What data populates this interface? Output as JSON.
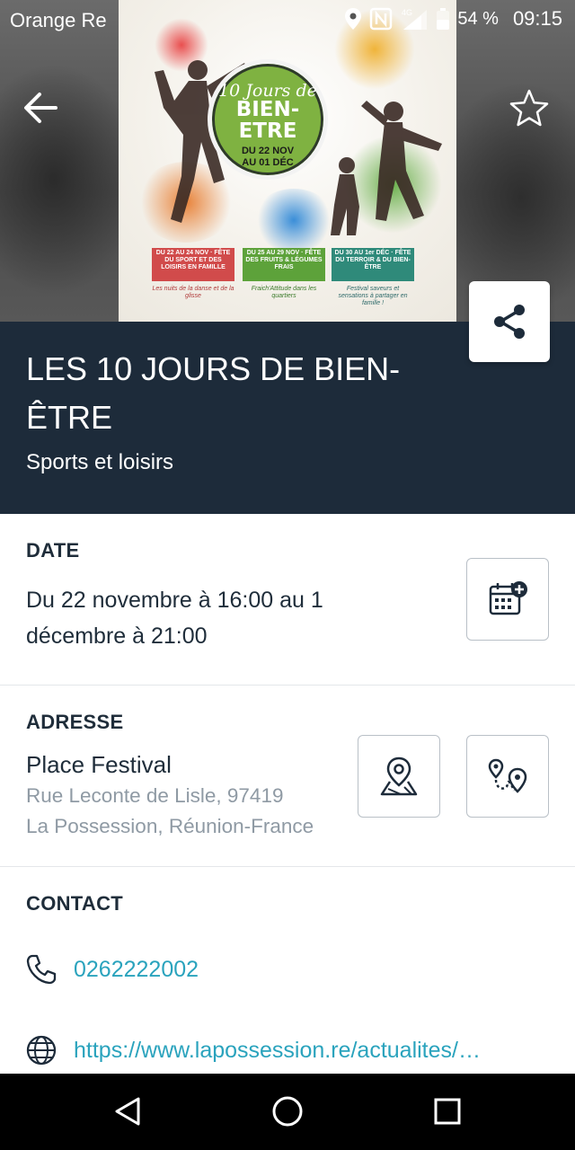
{
  "status_bar": {
    "carrier": "Orange Re",
    "network": "4G",
    "battery": "54 %",
    "time": "09:15"
  },
  "hero": {
    "poster": {
      "script_title": "10 Jours de",
      "main_title_line1": "BIEN-",
      "main_title_line2": "ETRE",
      "dates_line1": "DU 22 NOV",
      "dates_line2": "AU 01 DÉC",
      "banners": [
        {
          "text": "DU 22 AU 24 NOV · FÊTE DU SPORT ET DES LOISIRS EN FAMILLE",
          "note": "Les nuits de la danse et de la glisse"
        },
        {
          "text": "DU 25 AU 29 NOV · FÊTE DES FRUITS & LÉGUMES FRAIS",
          "note": "Fraich'Attitude dans les quartiers"
        },
        {
          "text": "DU 30 AU 1er DÉC · FÊTE DU TERROIR & DU BIEN-ÊTRE",
          "note": "Festival saveurs et sensations à partager en famille !"
        }
      ]
    },
    "icons": {
      "back": "arrow-left-icon",
      "favorite": "star-outline-icon",
      "share": "share-icon"
    }
  },
  "event": {
    "title": "LES 10 JOURS DE BIEN-ÊTRE",
    "category": "Sports et loisirs"
  },
  "date_section": {
    "label": "DATE",
    "text": "Du 22 novembre à 16:00 au 1 décembre à 21:00",
    "action_icon": "calendar-add-icon"
  },
  "address_section": {
    "label": "ADRESSE",
    "name": "Place Festival",
    "line1": "Rue Leconte de Lisle, 97419",
    "line2": "La Possession, Réunion-France",
    "action_icons": [
      "map-pin-icon",
      "route-icon"
    ]
  },
  "contact_section": {
    "label": "CONTACT",
    "phone": "0262222002",
    "website": "https://www.lapossession.re/actualites/…"
  },
  "colors": {
    "title_band": "#1d2b3a",
    "link": "#2aa3bd",
    "secondary_text": "#8f9aa4",
    "poster_green": "#7fb241"
  }
}
